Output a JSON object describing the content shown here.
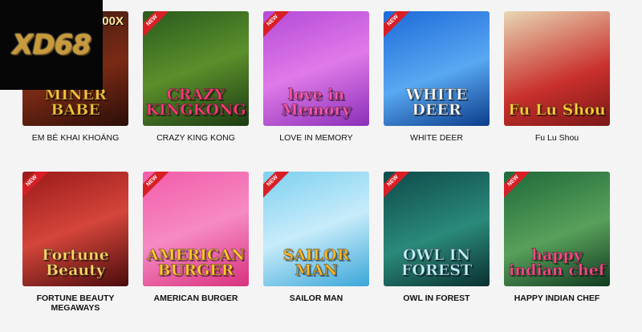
{
  "brand": {
    "logo_text": "XD68"
  },
  "games": [
    {
      "label": "EM BÉ KHAI KHOÁNG",
      "art_title": "MINER BABE",
      "multiplier": "00X",
      "is_new": false,
      "bg": "linear-gradient(160deg,#3a1b12 0%,#7a2a14 55%,#2b0e08 100%)",
      "title_color": "#f4c23c"
    },
    {
      "label": "CRAZY KING KONG",
      "art_title": "CRAZY KINGKONG",
      "is_new": true,
      "bg": "linear-gradient(160deg,#2a5a1e 0%,#5b8f2b 50%,#1b3a12 100%)",
      "title_color": "#ff3a7a"
    },
    {
      "label": "LOVE IN MEMORY",
      "art_title": "love in Memory",
      "is_new": true,
      "bg": "linear-gradient(160deg,#b44ad8 0%,#e07ae8 50%,#8a2fb8 100%)",
      "title_color": "#ff5aa8"
    },
    {
      "label": "WHITE DEER",
      "art_title": "WHITE DEER",
      "is_new": true,
      "bg": "linear-gradient(160deg,#1d6ad8 0%,#58a8f2 55%,#0b3c8a 100%)",
      "title_color": "#ffffff"
    },
    {
      "label": "Fu Lu Shou",
      "art_title": "Fu Lu Shou",
      "is_new": false,
      "bg": "linear-gradient(160deg,#e8d7b4 0%,#c9302c 60%,#7a1818 100%)",
      "title_color": "#ffd23a"
    },
    {
      "label": "FORTUNE BEAUTY MEGAWAYS",
      "art_title": "Fortune Beauty",
      "is_new": true,
      "bg": "linear-gradient(160deg,#9a1a1a 0%,#d4453a 50%,#4a0c0c 100%)",
      "title_color": "#ffd86a"
    },
    {
      "label": "AMERICAN BURGER",
      "art_title": "AMERICAN BURGER",
      "is_new": true,
      "bg": "linear-gradient(160deg,#f25ca8 0%,#f68ac4 50%,#d8327e 100%)",
      "title_color": "#ffcc2a"
    },
    {
      "label": "SAILOR MAN",
      "art_title": "SAILOR MAN",
      "is_new": true,
      "bg": "linear-gradient(160deg,#7dd0f0 0%,#c7ecfa 50%,#3aa6d8 100%)",
      "title_color": "#ffb62a"
    },
    {
      "label": "OWL IN FOREST",
      "art_title": "OWL IN FOREST",
      "is_new": true,
      "bg": "linear-gradient(160deg,#0e4a4a 0%,#2a8a7a 55%,#0a3030 100%)",
      "title_color": "#bff0ff"
    },
    {
      "label": "HAPPY INDIAN CHEF",
      "art_title": "happy indian chef",
      "is_new": true,
      "bg": "linear-gradient(160deg,#1f6a3a 0%,#58a05a 55%,#103a20 100%)",
      "title_color": "#ff4a8a"
    }
  ]
}
